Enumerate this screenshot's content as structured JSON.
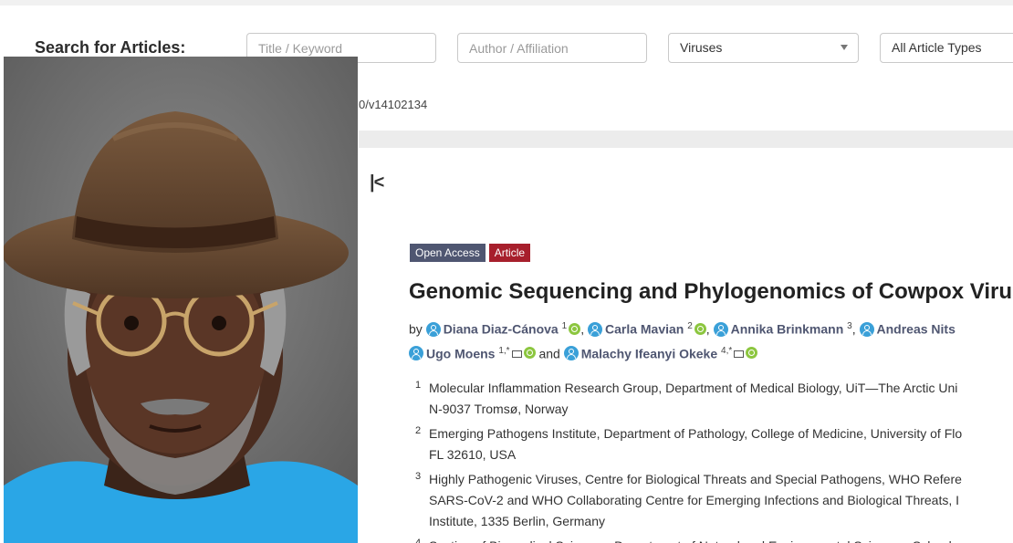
{
  "search": {
    "label": "Search for Articles:",
    "title_placeholder": "Title / Keyword",
    "author_placeholder": "Author / Affiliation",
    "journal_selected": "Viruses",
    "type_selected": "All Article Types"
  },
  "article": {
    "doi_fragment": "0/v14102134",
    "first_page_icon": "first-page-icon",
    "badges": [
      "Open Access",
      "Article"
    ],
    "title": "Genomic Sequencing and Phylogenomics of Cowpox Virus",
    "by": "by",
    "and": "and",
    "authors": [
      {
        "name": "Diana Diaz-Cánova",
        "sup": "1"
      },
      {
        "name": "Carla Mavian",
        "sup": "2"
      },
      {
        "name": "Annika Brinkmann",
        "sup": "3"
      },
      {
        "name": "Andreas Nits",
        "sup": ""
      },
      {
        "name": "Ugo Moens",
        "sup": "1,*"
      },
      {
        "name": "Malachy Ifeanyi Okeke",
        "sup": "4,*"
      }
    ],
    "affiliations": [
      {
        "num": "1",
        "line1": "Molecular Inflammation Research Group, Department of Medical Biology, UiT—The Arctic Uni",
        "line2": "N-9037 Tromsø, Norway"
      },
      {
        "num": "2",
        "line1": "Emerging Pathogens Institute, Department of Pathology, College of Medicine, University of Flo",
        "line2": "FL 32610, USA"
      },
      {
        "num": "3",
        "line1": "Highly Pathogenic Viruses, Centre for Biological Threats and Special Pathogens, WHO Refere",
        "line2": "SARS-CoV-2 and WHO Collaborating Centre for Emerging Infections and Biological Threats, I",
        "line3": "Institute, 1335 Berlin, Germany"
      },
      {
        "num": "4",
        "line1": "Section of Biomedical Sciences, Department of Natural and Environmental Sciences, School o"
      }
    ]
  },
  "colors": {
    "badge_open": "#4f5671",
    "badge_article": "#a71f2c",
    "author_link": "#4f5671",
    "orcid": "#8cc63f",
    "person_icon": "#3aa0d8"
  }
}
